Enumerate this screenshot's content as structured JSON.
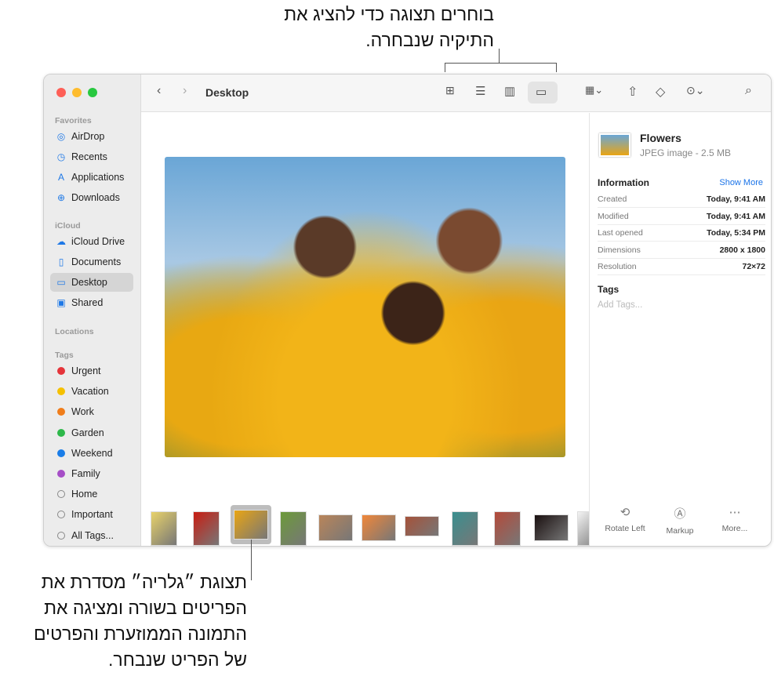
{
  "callouts": {
    "top": [
      "בוחרים תצוגה כדי להציג את",
      "התיקיה שנבחרה."
    ],
    "bottom": [
      "תצוגת ״גלריה״ מסדרת את",
      "הפריטים בשורה ומציגה את",
      "התמונה הממוזערת והפרטים",
      "של הפריט שנבחר."
    ]
  },
  "window": {
    "title": "Desktop"
  },
  "sidebar": {
    "favorites_label": "Favorites",
    "favorites": [
      {
        "label": "AirDrop",
        "icon": "◎"
      },
      {
        "label": "Recents",
        "icon": "◷"
      },
      {
        "label": "Applications",
        "icon": "A"
      },
      {
        "label": "Downloads",
        "icon": "⊕"
      }
    ],
    "icloud_label": "iCloud",
    "icloud": [
      {
        "label": "iCloud Drive",
        "icon": "☁"
      },
      {
        "label": "Documents",
        "icon": "▯"
      },
      {
        "label": "Desktop",
        "icon": "▭"
      },
      {
        "label": "Shared",
        "icon": "▣"
      }
    ],
    "locations_label": "Locations",
    "tags_label": "Tags",
    "tags": [
      {
        "label": "Urgent",
        "color": "#e5343a"
      },
      {
        "label": "Vacation",
        "color": "#f5c000"
      },
      {
        "label": "Work",
        "color": "#f07d1a"
      },
      {
        "label": "Garden",
        "color": "#2db84a"
      },
      {
        "label": "Weekend",
        "color": "#1a7de8"
      },
      {
        "label": "Family",
        "color": "#a64ec7"
      },
      {
        "label": "Home",
        "color": ""
      },
      {
        "label": "Important",
        "color": ""
      },
      {
        "label": "All Tags...",
        "color": ""
      }
    ]
  },
  "preview": {
    "name": "Flowers",
    "kind": "JPEG image - 2.5 MB",
    "info_label": "Information",
    "show_more": "Show More",
    "rows": [
      {
        "k": "Created",
        "v": "Today, 9:41 AM"
      },
      {
        "k": "Modified",
        "v": "Today, 9:41 AM"
      },
      {
        "k": "Last opened",
        "v": "Today, 5:34 PM"
      },
      {
        "k": "Dimensions",
        "v": "2800 x 1800"
      },
      {
        "k": "Resolution",
        "v": "72×72"
      }
    ],
    "tags_label": "Tags",
    "tags_placeholder": "Add Tags...",
    "actions": [
      {
        "label": "Rotate Left",
        "icon": "⟲"
      },
      {
        "label": "Markup",
        "icon": "Ⓐ"
      },
      {
        "label": "More...",
        "icon": "⋯"
      }
    ]
  },
  "thumbs": [
    "#e8d26a",
    "#c81d12",
    "#e9a514",
    "#6c9a3a",
    "#b9855a",
    "#f0873a",
    "#a5523a",
    "#3a8f8f",
    "#b44a3a",
    "#1a1010",
    "#f3f3f3"
  ]
}
